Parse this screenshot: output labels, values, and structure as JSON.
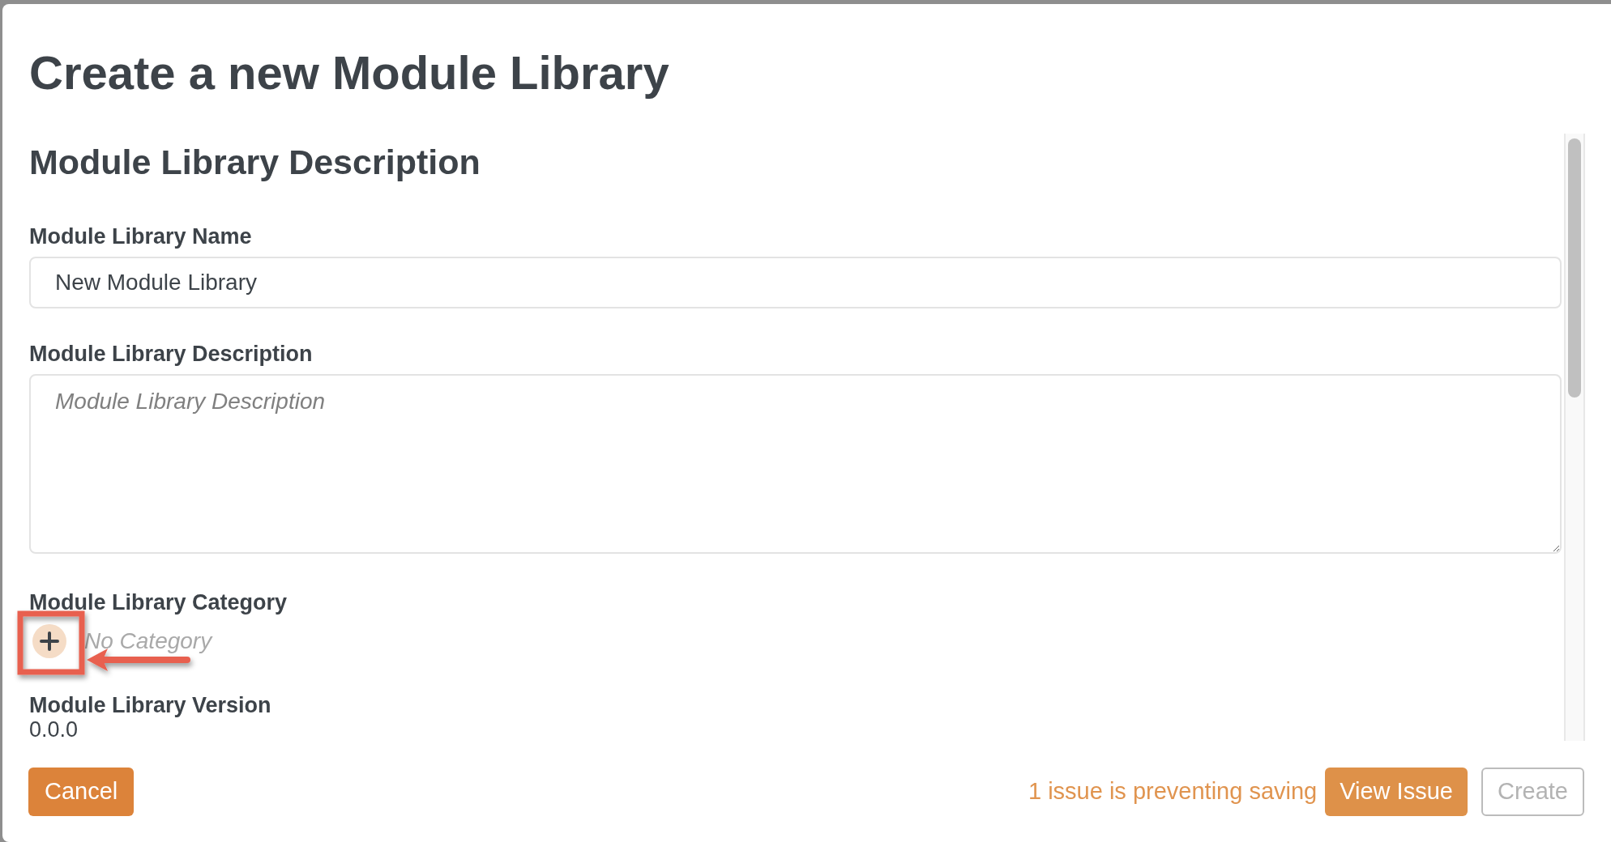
{
  "dialog": {
    "title": "Create a new Module Library",
    "section_title": "Module Library Description",
    "fields": [
      {
        "kind": "text",
        "label": "Module Library Name",
        "value": "New Module Library"
      },
      {
        "kind": "textarea",
        "label": "Module Library Description",
        "placeholder": "Module Library Description"
      },
      {
        "kind": "category",
        "label": "Module Library Category",
        "placeholder": "No Category"
      },
      {
        "kind": "static",
        "label": "Module Library Version",
        "value": "0.0.0"
      }
    ],
    "footer": {
      "cancel": "Cancel",
      "issue_message": "1 issue is preventing saving",
      "view_issue": "View Issue",
      "create": {
        "label": "Create",
        "disabled": true
      }
    }
  }
}
